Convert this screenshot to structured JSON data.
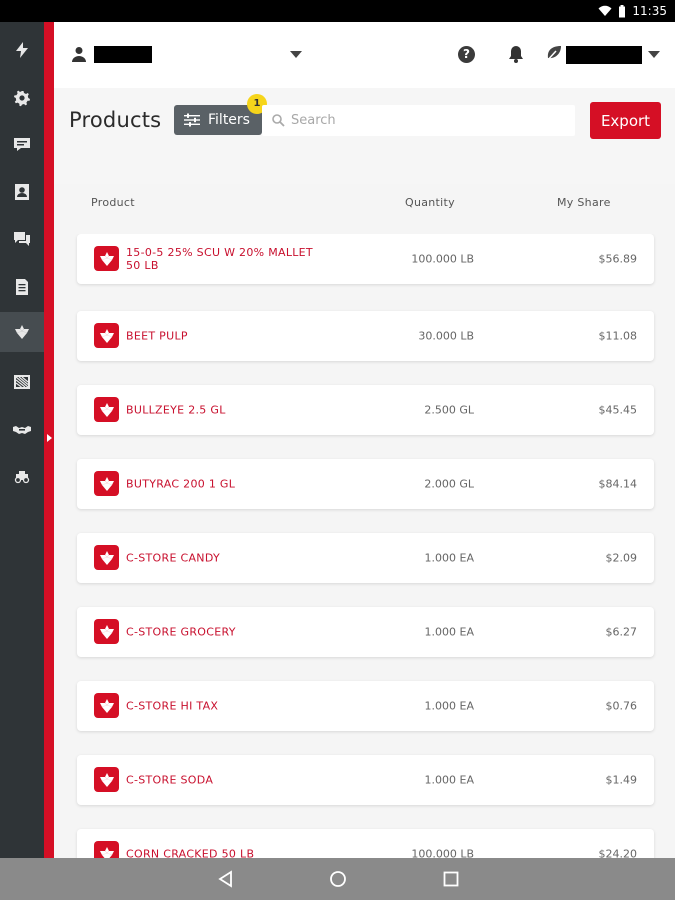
{
  "status": {
    "time": "11:35"
  },
  "header": {
    "user_name": "",
    "account_name": ""
  },
  "page": {
    "title": "Products"
  },
  "toolbar": {
    "filters_label": "Filters",
    "filters_count": "1",
    "search_placeholder": "Search",
    "export_label": "Export"
  },
  "table": {
    "columns": {
      "product": "Product",
      "quantity": "Quantity",
      "share": "My Share"
    },
    "rows": [
      {
        "name": "15-0-5 25% SCU W 20% MALLET 50 LB",
        "qty": "100.000 LB",
        "share": "$56.89"
      },
      {
        "name": "BEET PULP",
        "qty": "30.000 LB",
        "share": "$11.08"
      },
      {
        "name": "BULLZEYE 2.5 GL",
        "qty": "2.500 GL",
        "share": "$45.45"
      },
      {
        "name": "BUTYRAC 200 1 GL",
        "qty": "2.000 GL",
        "share": "$84.14"
      },
      {
        "name": "C-STORE CANDY",
        "qty": "1.000 EA",
        "share": "$2.09"
      },
      {
        "name": "C-STORE GROCERY",
        "qty": "1.000 EA",
        "share": "$6.27"
      },
      {
        "name": "C-STORE HI TAX",
        "qty": "1.000 EA",
        "share": "$0.76"
      },
      {
        "name": "C-STORE SODA",
        "qty": "1.000 EA",
        "share": "$1.49"
      },
      {
        "name": "CORN CRACKED 50 LB",
        "qty": "100.000 LB",
        "share": "$24.20"
      }
    ]
  },
  "colors": {
    "brand_red": "#d50f25",
    "sidebar": "#2f3437",
    "filters_badge": "#f6d51b"
  },
  "icons": {
    "sidebar": [
      "lightning-icon",
      "gear-icon",
      "chat-icon",
      "contacts-icon",
      "messages-icon",
      "document-icon",
      "products-icon",
      "grid-icon",
      "handshake-icon",
      "tractor-icon"
    ],
    "header": [
      "user-icon",
      "help-icon",
      "bell-icon",
      "leaf-icon"
    ]
  }
}
